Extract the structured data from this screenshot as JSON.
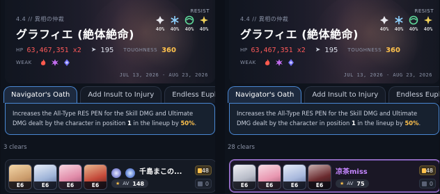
{
  "panels": [
    {
      "phase": "4.4 // 異相の仲裁",
      "boss_name": "グラフィエ (絶体絶命)",
      "hp_label": "HP",
      "hp_value": "63,467,351 x2",
      "speed": "195",
      "toughness_label": "TOUGHNESS",
      "toughness_value": "360",
      "weak_label": "WEAK",
      "weak_elements": [
        "fire-icon",
        "lightning-icon",
        "quantum-icon"
      ],
      "resist_label": "RESIST",
      "resists": [
        {
          "icon": "physical-icon",
          "value": "40%"
        },
        {
          "icon": "ice-icon",
          "value": "40%"
        },
        {
          "icon": "wind-icon",
          "value": "40%"
        },
        {
          "icon": "imaginary-icon",
          "value": "40%"
        }
      ],
      "date_range": "JUL 13, 2026 - AUG 23, 2026",
      "tabs": [
        "Navigator's Oath",
        "Add Insult to Injury",
        "Endless Euphoria"
      ],
      "description": {
        "pre": "Increases the All-Type RES PEN for the Skill DMG and Ultimate DMG dealt by the character in position ",
        "pos": "1",
        "mid": " in the lineup by ",
        "pct": "50%",
        "post": "."
      },
      "clears": "3 clears",
      "team": {
        "characters": [
          "E6",
          "E6",
          "E6",
          "E6"
        ],
        "light_cones": [
          "lightcone-icon",
          "lightcone-icon"
        ],
        "username": "千島まこの...",
        "av_label": "AV",
        "av_value": "148",
        "count_up": "48",
        "count_down": "0"
      }
    },
    {
      "phase": "4.4 // 異相の仲裁",
      "boss_name": "グラフィエ (絶体絶命)",
      "hp_label": "HP",
      "hp_value": "63,467,351 x2",
      "speed": "195",
      "toughness_label": "TOUGHNESS",
      "toughness_value": "360",
      "weak_label": "WEAK",
      "weak_elements": [
        "fire-icon",
        "lightning-icon",
        "quantum-icon"
      ],
      "resist_label": "RESIST",
      "resists": [
        {
          "icon": "physical-icon",
          "value": "40%"
        },
        {
          "icon": "ice-icon",
          "value": "40%"
        },
        {
          "icon": "wind-icon",
          "value": "40%"
        },
        {
          "icon": "imaginary-icon",
          "value": "40%"
        }
      ],
      "date_range": "JUL 13, 2026 - AUG 23, 2026",
      "tabs": [
        "Navigator's Oath",
        "Add Insult to Injury",
        "Endless Euphoria"
      ],
      "description": {
        "pre": "Increases the All-Type RES PEN for the Skill DMG and Ultimate DMG dealt by the character in position ",
        "pos": "1",
        "mid": " in the lineup by ",
        "pct": "50%",
        "post": "."
      },
      "clears": "28 clears",
      "team": {
        "characters": [
          "E6",
          "E6",
          "E6",
          "E6"
        ],
        "username": "凉茶miss",
        "av_label": "AV",
        "av_value": "75",
        "count_up": "48",
        "count_down": "0"
      }
    }
  ],
  "colors": {
    "accent_blue": "#4a88d4",
    "hp_red": "#ff5a5a",
    "gold": "#ffc24d",
    "purple_name": "#c586ff"
  }
}
